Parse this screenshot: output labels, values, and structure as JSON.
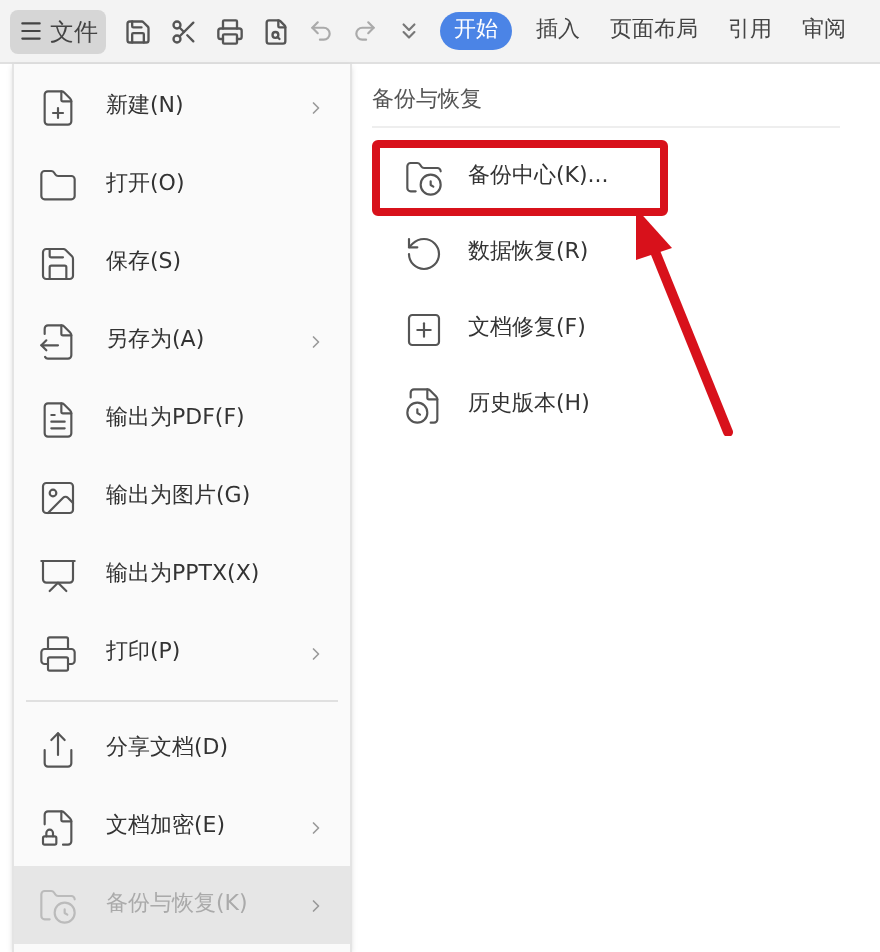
{
  "toolbar": {
    "file_button": "文件",
    "tabs": [
      {
        "label": "开始",
        "selected": true
      },
      {
        "label": "插入",
        "selected": false
      },
      {
        "label": "页面布局",
        "selected": false
      },
      {
        "label": "引用",
        "selected": false
      },
      {
        "label": "审阅",
        "selected": false
      }
    ]
  },
  "file_menu": {
    "items": [
      {
        "kind": "item",
        "label": "新建(N)",
        "has_submenu": true,
        "selected": false
      },
      {
        "kind": "item",
        "label": "打开(O)",
        "has_submenu": false,
        "selected": false
      },
      {
        "kind": "item",
        "label": "保存(S)",
        "has_submenu": false,
        "selected": false
      },
      {
        "kind": "item",
        "label": "另存为(A)",
        "has_submenu": true,
        "selected": false
      },
      {
        "kind": "item",
        "label": "输出为PDF(F)",
        "has_submenu": false,
        "selected": false
      },
      {
        "kind": "item",
        "label": "输出为图片(G)",
        "has_submenu": false,
        "selected": false
      },
      {
        "kind": "item",
        "label": "输出为PPTX(X)",
        "has_submenu": false,
        "selected": false
      },
      {
        "kind": "item",
        "label": "打印(P)",
        "has_submenu": true,
        "selected": false
      },
      {
        "kind": "divider"
      },
      {
        "kind": "item",
        "label": "分享文档(D)",
        "has_submenu": false,
        "selected": false
      },
      {
        "kind": "item",
        "label": "文档加密(E)",
        "has_submenu": true,
        "selected": false
      },
      {
        "kind": "item",
        "label": "备份与恢复(K)",
        "has_submenu": true,
        "selected": true
      }
    ]
  },
  "submenu": {
    "title": "备份与恢复",
    "items": [
      {
        "label": "备份中心(K)...",
        "highlighted": true
      },
      {
        "label": "数据恢复(R)",
        "highlighted": false
      },
      {
        "label": "文档修复(F)",
        "highlighted": false
      },
      {
        "label": "历史版本(H)",
        "highlighted": false
      }
    ]
  }
}
